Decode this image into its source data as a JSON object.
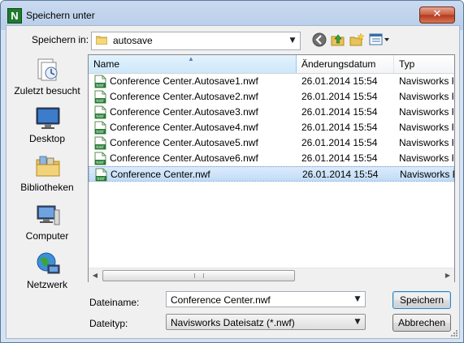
{
  "window": {
    "title": "Speichern unter",
    "app_icon_letter": "N",
    "close_label": "✕"
  },
  "toolbar": {
    "save_in_label": "Speichern in:",
    "save_in_value": "autosave",
    "icons": [
      "back-icon",
      "up-folder-icon",
      "new-folder-icon",
      "view-menu-icon"
    ]
  },
  "places": [
    {
      "label": "Zuletzt besucht",
      "icon": "recent-places-icon"
    },
    {
      "label": "Desktop",
      "icon": "desktop-icon"
    },
    {
      "label": "Bibliotheken",
      "icon": "libraries-icon"
    },
    {
      "label": "Computer",
      "icon": "computer-icon"
    },
    {
      "label": "Netzwerk",
      "icon": "network-icon"
    }
  ],
  "filelist": {
    "columns": {
      "name": "Name",
      "date": "Änderungsdatum",
      "type": "Typ"
    },
    "rows": [
      {
        "name": "Conference Center.Autosave1.nwf",
        "date": "26.01.2014 15:54",
        "type": "Navisworks F"
      },
      {
        "name": "Conference Center.Autosave2.nwf",
        "date": "26.01.2014 15:54",
        "type": "Navisworks F"
      },
      {
        "name": "Conference Center.Autosave3.nwf",
        "date": "26.01.2014 15:54",
        "type": "Navisworks F"
      },
      {
        "name": "Conference Center.Autosave4.nwf",
        "date": "26.01.2014 15:54",
        "type": "Navisworks F"
      },
      {
        "name": "Conference Center.Autosave5.nwf",
        "date": "26.01.2014 15:54",
        "type": "Navisworks F"
      },
      {
        "name": "Conference Center.Autosave6.nwf",
        "date": "26.01.2014 15:54",
        "type": "Navisworks F"
      },
      {
        "name": "Conference Center.nwf",
        "date": "26.01.2014 15:54",
        "type": "Navisworks F",
        "selected": true
      }
    ]
  },
  "form": {
    "filename_label": "Dateiname:",
    "filename_value": "Conference Center.nwf",
    "filetype_label": "Dateityp:",
    "filetype_value": "Navisworks Dateisatz (*.nwf)"
  },
  "buttons": {
    "save": "Speichern",
    "cancel": "Abbrechen"
  }
}
